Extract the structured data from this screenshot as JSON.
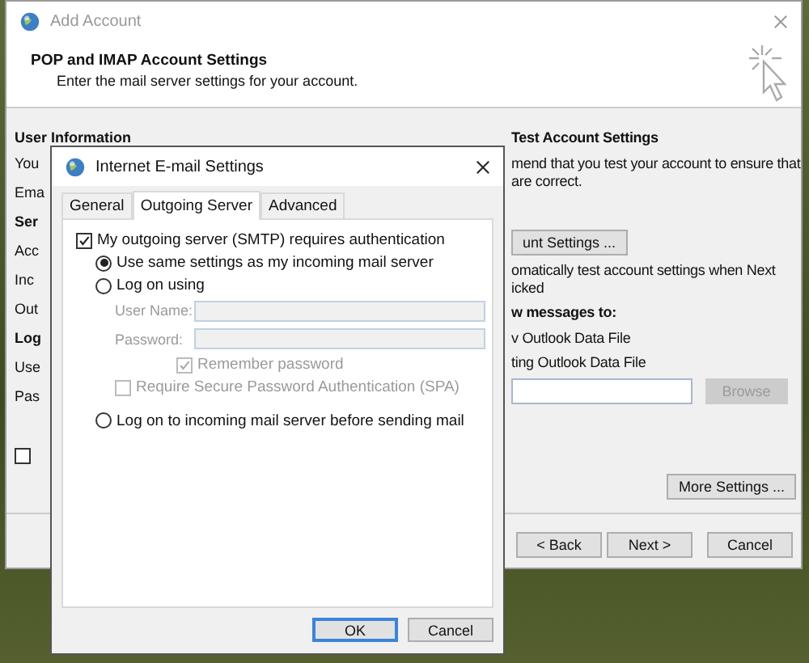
{
  "back_window": {
    "title": "Add Account",
    "header": {
      "title": "POP and IMAP Account Settings",
      "subtitle": "Enter the mail server settings for your account."
    },
    "left_column": [
      {
        "kind": "heading",
        "text": "User Information"
      },
      {
        "kind": "label",
        "text": "You"
      },
      {
        "kind": "label",
        "text": "Ema"
      },
      {
        "kind": "heading",
        "text": "Ser"
      },
      {
        "kind": "label",
        "text": "Acc"
      },
      {
        "kind": "label",
        "text": "Inc"
      },
      {
        "kind": "label",
        "text": "Out"
      },
      {
        "kind": "heading",
        "text": "Log"
      },
      {
        "kind": "label",
        "text": "Use"
      },
      {
        "kind": "label",
        "text": "Pas"
      }
    ],
    "left_checkbox": {
      "checked": false
    },
    "right_column": [
      {
        "kind": "heading",
        "text": "Test Account Settings"
      },
      {
        "kind": "text",
        "text": "mend that you test your account to ensure that"
      },
      {
        "kind": "cont",
        "text": "are correct."
      },
      {
        "kind": "button",
        "text": "unt Settings ..."
      },
      {
        "kind": "text",
        "text": "omatically test account settings when Next"
      },
      {
        "kind": "cont",
        "text": "icked"
      },
      {
        "kind": "heading",
        "text": "w messages to:"
      },
      {
        "kind": "text",
        "text": "v Outlook Data File"
      },
      {
        "kind": "text",
        "text": "ting Outlook Data File"
      }
    ],
    "browse_button": {
      "label": "Browse",
      "disabled": true
    },
    "more_settings_button": "More Settings ...",
    "footer_buttons": [
      {
        "label": "< Back"
      },
      {
        "label": "Next >"
      },
      {
        "label": "Cancel"
      }
    ]
  },
  "dialog": {
    "title": "Internet E-mail Settings",
    "tabs": [
      {
        "label": "General",
        "selected": false
      },
      {
        "label": "Outgoing Server",
        "selected": true
      },
      {
        "label": "Advanced",
        "selected": false
      }
    ],
    "options": [
      {
        "kind": "checkbox",
        "label": "My outgoing server (SMTP) requires authentication",
        "checked": true,
        "disabled": false,
        "children": [
          {
            "kind": "radio",
            "label": "Use same settings as my incoming mail server",
            "selected": true
          },
          {
            "kind": "radio",
            "label": "Log on using",
            "selected": false,
            "children": [
              {
                "kind": "field",
                "label": "User Name:",
                "disabled": true
              },
              {
                "kind": "field",
                "label": "Password:",
                "disabled": true
              },
              {
                "kind": "sub-checkbox",
                "label": "Remember password",
                "checked": true,
                "disabled": true
              },
              {
                "kind": "checkbox",
                "label": "Require Secure Password Authentication (SPA)",
                "checked": false,
                "disabled": true
              }
            ]
          },
          {
            "kind": "radio",
            "label": "Log on to incoming mail server before sending mail",
            "selected": false
          }
        ]
      }
    ],
    "buttons": [
      {
        "label": "OK",
        "default": true
      },
      {
        "label": "Cancel",
        "default": false
      }
    ]
  }
}
